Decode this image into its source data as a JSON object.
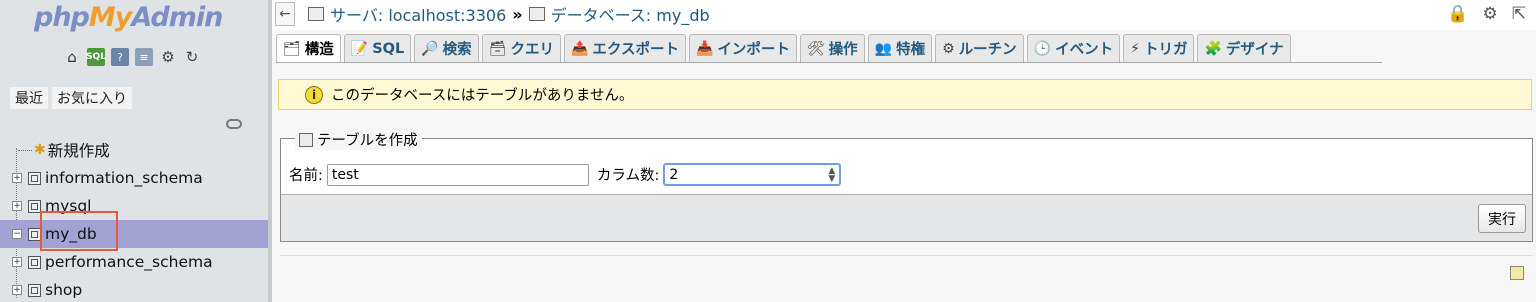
{
  "sidebar": {
    "logo": {
      "php": "php",
      "my": "My",
      "admin": "Admin"
    },
    "quick_icons": [
      "home-icon",
      "sql-icon",
      "docs-icon",
      "help-icon",
      "settings-icon",
      "reload-icon"
    ],
    "tabs": [
      {
        "label": "最近"
      },
      {
        "label": "お気に入り"
      }
    ],
    "tree": [
      {
        "label": "新規作成"
      },
      {
        "label": "information_schema"
      },
      {
        "label": "mysql"
      },
      {
        "label": "my_db"
      },
      {
        "label": "performance_schema"
      },
      {
        "label": "shop"
      }
    ]
  },
  "breadcrumb": {
    "server": "サーバ: localhost:3306",
    "sep": "»",
    "database": "データベース: my_db"
  },
  "tabs": [
    {
      "label": "構造",
      "icon": "structure-icon",
      "glyph": "🗂",
      "active": true
    },
    {
      "label": "SQL",
      "icon": "sql-icon",
      "glyph": "📝"
    },
    {
      "label": "検索",
      "icon": "search-icon",
      "glyph": "🔎"
    },
    {
      "label": "クエリ",
      "icon": "query-icon",
      "glyph": "🗃"
    },
    {
      "label": "エクスポート",
      "icon": "export-icon",
      "glyph": "📤"
    },
    {
      "label": "インポート",
      "icon": "import-icon",
      "glyph": "📥"
    },
    {
      "label": "操作",
      "icon": "operations-icon",
      "glyph": "🛠"
    },
    {
      "label": "特権",
      "icon": "privileges-icon",
      "glyph": "👥"
    },
    {
      "label": "ルーチン",
      "icon": "routines-icon",
      "glyph": "⚙"
    },
    {
      "label": "イベント",
      "icon": "events-icon",
      "glyph": "🕒"
    },
    {
      "label": "トリガ",
      "icon": "triggers-icon",
      "glyph": "⚡"
    },
    {
      "label": "デザイナ",
      "icon": "designer-icon",
      "glyph": "🧩"
    }
  ],
  "notice": {
    "text": "このデータベースにはテーブルがありません。"
  },
  "create_table": {
    "legend": "テーブルを作成",
    "name_label": "名前:",
    "name_value": "test",
    "columns_label": "カラム数:",
    "columns_value": "2",
    "go_label": "実行"
  }
}
